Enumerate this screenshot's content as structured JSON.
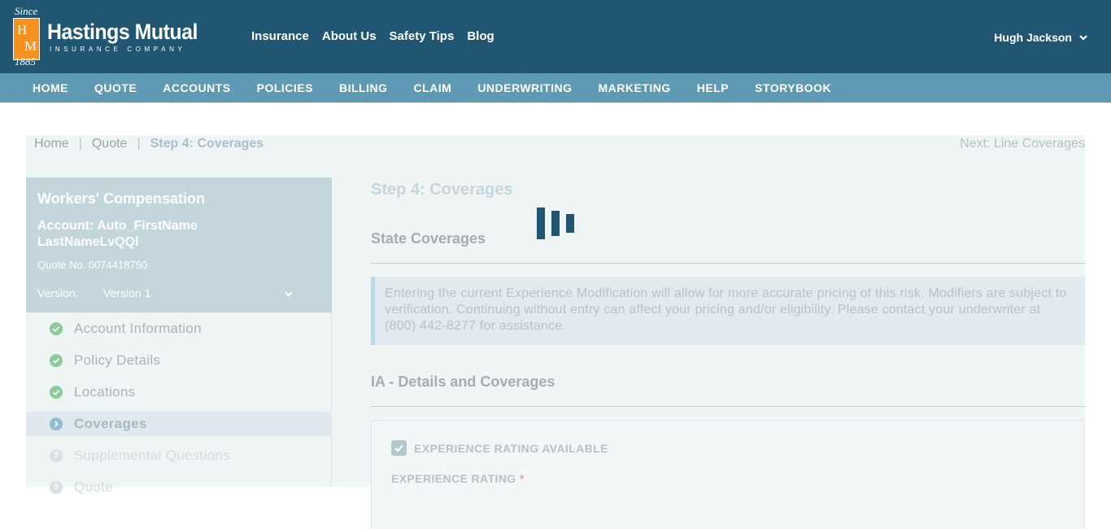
{
  "brand": {
    "since": "Since",
    "letters": [
      "H",
      "M"
    ],
    "year": "1885",
    "name": "Hastings Mutual",
    "tagline": "INSURANCE COMPANY"
  },
  "topnav": [
    {
      "label": "Insurance"
    },
    {
      "label": "About Us"
    },
    {
      "label": "Safety Tips"
    },
    {
      "label": "Blog"
    }
  ],
  "user": {
    "name": "Hugh Jackson",
    "icon": "chevron-down-icon"
  },
  "mainnav": [
    {
      "label": "HOME"
    },
    {
      "label": "QUOTE"
    },
    {
      "label": "ACCOUNTS"
    },
    {
      "label": "POLICIES"
    },
    {
      "label": "BILLING"
    },
    {
      "label": "CLAIM"
    },
    {
      "label": "UNDERWRITING"
    },
    {
      "label": "MARKETING"
    },
    {
      "label": "HELP"
    },
    {
      "label": "STORYBOOK"
    }
  ],
  "breadcrumb": {
    "items": [
      "Home",
      "Quote"
    ],
    "current": "Step 4: Coverages",
    "separator": "|",
    "next": "Next: Line Coverages"
  },
  "sidebar": {
    "program": "Workers' Compensation",
    "account": "Account: Auto_FirstName LastNameLvQQl",
    "quote_no": "Quote No. 0074418750",
    "version_label": "Version:",
    "version_value": "Version 1",
    "steps": [
      {
        "label": "Account Information",
        "status": "done"
      },
      {
        "label": "Policy Details",
        "status": "done"
      },
      {
        "label": "Locations",
        "status": "done"
      },
      {
        "label": "Coverages",
        "status": "active"
      },
      {
        "label": "Supplemental Questions",
        "status": "pending"
      },
      {
        "label": "Quote",
        "status": "pending"
      }
    ]
  },
  "content": {
    "step_title": "Step 4: Coverages",
    "state_title": "State Coverages",
    "info_text": "Entering the current Experience Modification will allow for more accurate pricing of this risk. Modifiers are subject to verification. Continuing without entry can affect your pricing and/or eligibility. Please contact your underwriter at (800) 442-8277 for assistance.",
    "section_title": "IA - Details and Coverages",
    "experience_rating_available": {
      "label": "EXPERIENCE RATING AVAILABLE",
      "checked": true
    },
    "experience_rating_label": "EXPERIENCE RATING",
    "required_marker": "*"
  },
  "colors": {
    "header": "#215673",
    "subnav": "#5f9ab4",
    "brand_orange": "#f5921e",
    "done": "#8ccb95",
    "active": "#8fbcd2"
  }
}
